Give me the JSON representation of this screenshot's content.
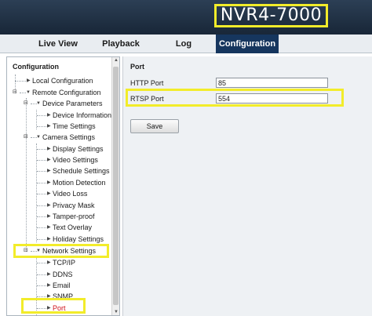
{
  "header": {
    "brand": "NVR4-7000"
  },
  "nav": {
    "tabs": [
      "Live View",
      "Playback",
      "Log",
      "Configuration"
    ],
    "active": "Configuration"
  },
  "sidebar": {
    "title": "Configuration",
    "items": [
      "Local Configuration",
      "Remote Configuration",
      "Device Parameters",
      "Device Information",
      "Time Settings",
      "Camera Settings",
      "Display Settings",
      "Video Settings",
      "Schedule Settings",
      "Motion Detection",
      "Video Loss",
      "Privacy Mask",
      "Tamper-proof",
      "Text Overlay",
      "Holiday Settings",
      "Network Settings",
      "TCP/IP",
      "DDNS",
      "Email",
      "SNMP",
      "Port"
    ],
    "selected": "Port"
  },
  "main": {
    "title": "Port",
    "fields": [
      {
        "label": "HTTP Port",
        "value": "85"
      },
      {
        "label": "RTSP Port",
        "value": "554"
      }
    ],
    "save_label": "Save"
  },
  "colors": {
    "highlight": "#f2ec2a",
    "active_tab": "#16365e",
    "selected_item": "#d0121b"
  },
  "icons": {
    "collapsed": "triangle-right-icon",
    "expanded": "triangle-down-icon",
    "scroll_up": "arrow-up-icon",
    "scroll_down": "arrow-down-icon"
  }
}
